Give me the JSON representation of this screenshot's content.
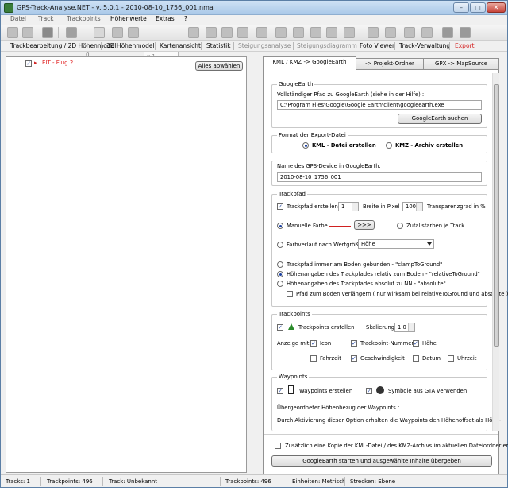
{
  "window": {
    "title": "GPS-Track-Analyse.NET  -  v. 5.0.1  -  2010-08-10_1756_001.nma"
  },
  "menu": [
    "Datei",
    "Track",
    "Trackpoints",
    "Höhenwerte",
    "Extras",
    "?"
  ],
  "toolbar": {
    "zoom_value": "x 1",
    "count_value": "0"
  },
  "navbar": {
    "items": [
      {
        "label": "Trackbearbeitung / 2D Höhenmodell"
      },
      {
        "label": "3D Höhenmodell"
      },
      {
        "label": "Kartenansicht"
      },
      {
        "label": "Statistik"
      },
      {
        "label": "Steigungsanalyse"
      },
      {
        "label": "Steigungsdiagramm"
      },
      {
        "label": "Foto Viewer"
      },
      {
        "label": "Track-Verwaltung"
      },
      {
        "label": "Export"
      }
    ]
  },
  "left": {
    "track_label": "EIT - Flug 2",
    "select_all_label": "Alles abwählen"
  },
  "tabs": [
    "KML / KMZ -> GoogleEarth",
    "-> Projekt-Ordner",
    "GPX -> MapSource"
  ],
  "ge": {
    "title": "GoogleEarth",
    "path_label": "Vollständiger Pfad zu GoogleEarth (siehe in der Hilfe) :",
    "path_value": "C:\\Program Files\\Google\\Google Earth\\client\\googleearth.exe",
    "search_label": "GoogleEarth suchen"
  },
  "format": {
    "title": "Format der Export-Datei",
    "kml_label": "KML - Datei erstellen",
    "kmz_label": "KMZ - Archiv erstellen"
  },
  "device": {
    "title": "Name des GPS-Device in GoogleEarth:",
    "value": "2010-08-10_1756_001"
  },
  "trackpfad": {
    "title": "Trackpfad",
    "create_label": "Trackpfad erstellen",
    "width_value": "1",
    "width_label": "Breite in Pixel",
    "transp_value": "100",
    "transp_label": "Transparenzgrad in %",
    "manual_color_label": "Manuelle Farbe",
    "color_button_label": ">>>",
    "random_color_label": "Zufallsfarben je Track",
    "gradient_label": "Farbverlauf nach Wertgröße",
    "gradient_select": "Höhe",
    "clamp_label": "Trackpfad immer am Boden gebunden - \"clampToGround\"",
    "relative_label": "Höhenangaben des Trackpfades relativ zum Boden - \"relativeToGround\"",
    "absolute_label": "Höhenangaben des Trackpfades absolut zu NN - \"absolute\"",
    "extend_label": "Pfad zum Boden verlängern ( nur wirksam bei relativeToGround und absolute )"
  },
  "trackpoints": {
    "title": "Trackpoints",
    "create_label": "Trackpoints erstellen",
    "scale_label": "Skalierung",
    "scale_value": "1.0",
    "show_label": "Anzeige mit :",
    "icon_label": "Icon",
    "number_label": "Trackpoint-Nummer",
    "height_label": "Höhe",
    "time_label": "Fahrzeit",
    "speed_label": "Geschwindigkeit",
    "date_label": "Datum",
    "clock_label": "Uhrzeit"
  },
  "waypoints": {
    "title": "Waypoints",
    "create_label": "Waypoints erstellen",
    "gta_label": "Symbole aus GTA verwenden",
    "ref_label": "Übergeordneter Höhenbezug der Waypoints :",
    "desc_label": "Durch Aktivierung dieser Option erhalten die Waypoints den Höhenoffset als Höhe-"
  },
  "bottom": {
    "copy_label": "Zusätzlich eine Kopie der KML-Datei / des KMZ-Archivs im aktuellen Dateiordner erstellen",
    "start_label": "GoogleEarth starten und ausgewählte Inhalte übergeben"
  },
  "status": {
    "tracks": "Tracks: 1",
    "trackpoints_left": "Trackpoints: 496",
    "track": "Track: Unbekannt",
    "trackpoints_right": "Trackpoints: 496",
    "units": "Einheiten: Metrisch",
    "distance": "Strecken: Ebene"
  }
}
